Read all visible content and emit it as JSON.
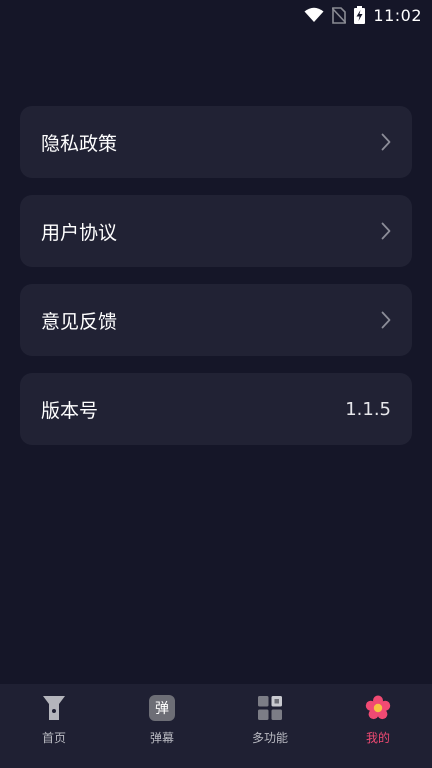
{
  "status_bar": {
    "time": "11:02",
    "icons": [
      "wifi-icon",
      "no-sim-icon",
      "battery-charging-icon"
    ]
  },
  "menu": {
    "items": [
      {
        "label": "隐私政策",
        "icon": "chevron-right-icon"
      },
      {
        "label": "用户协议",
        "icon": "chevron-right-icon"
      },
      {
        "label": "意见反馈",
        "icon": "chevron-right-icon"
      }
    ],
    "version": {
      "label": "版本号",
      "value": "1.1.5"
    }
  },
  "bottom_nav": {
    "items": [
      {
        "label": "首页",
        "icon": "flashlight-icon"
      },
      {
        "label": "弹幕",
        "icon": "danmaku-icon",
        "glyph": "弹"
      },
      {
        "label": "多功能",
        "icon": "grid-icon"
      },
      {
        "label": "我的",
        "icon": "flower-icon",
        "active": true
      }
    ],
    "active_color": "#f04a73",
    "inactive_color": "#b9bac2"
  },
  "colors": {
    "background": "#151628",
    "card": "#212234",
    "nav_background": "#1f2033"
  }
}
